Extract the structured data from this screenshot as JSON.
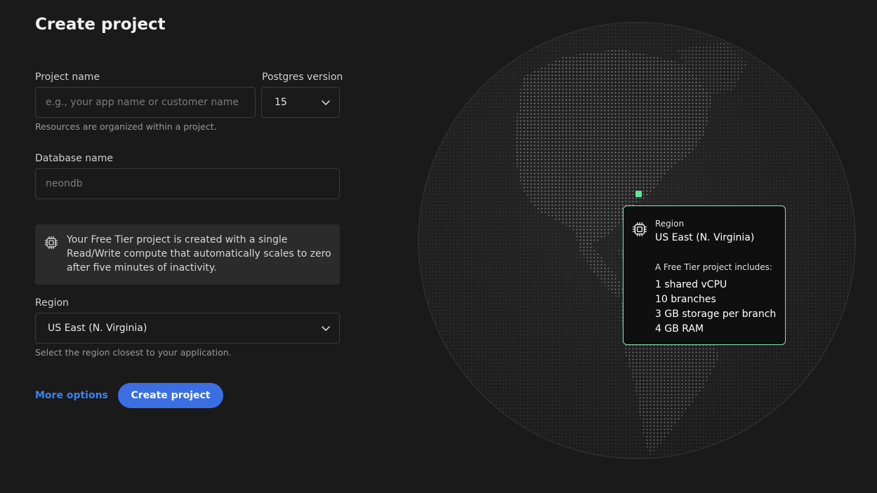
{
  "page": {
    "title": "Create project"
  },
  "form": {
    "project_name": {
      "label": "Project name",
      "placeholder": "e.g., your app name or customer name",
      "help": "Resources are organized within a project."
    },
    "postgres_version": {
      "label": "Postgres version",
      "value": "15"
    },
    "database_name": {
      "label": "Database name",
      "placeholder": "neondb"
    },
    "info": {
      "icon": "chip-icon",
      "text": "Your Free Tier project is created with a single Read/Write compute that automatically scales to zero after five minutes of inactivity."
    },
    "region": {
      "label": "Region",
      "value": "US East (N. Virginia)",
      "help": "Select the region closest to your application."
    }
  },
  "actions": {
    "more_options": "More options",
    "create": "Create project"
  },
  "globe": {
    "tooltip": {
      "label": "Region",
      "value": "US East (N. Virginia)",
      "heading": "A Free Tier project includes:",
      "items": [
        "1 shared vCPU",
        "10 branches",
        "3 GB storage per branch",
        "4 GB RAM"
      ]
    }
  },
  "colors": {
    "accent": "#3b6ee0",
    "link": "#3b82f6",
    "region_highlight": "#5ee89b"
  }
}
